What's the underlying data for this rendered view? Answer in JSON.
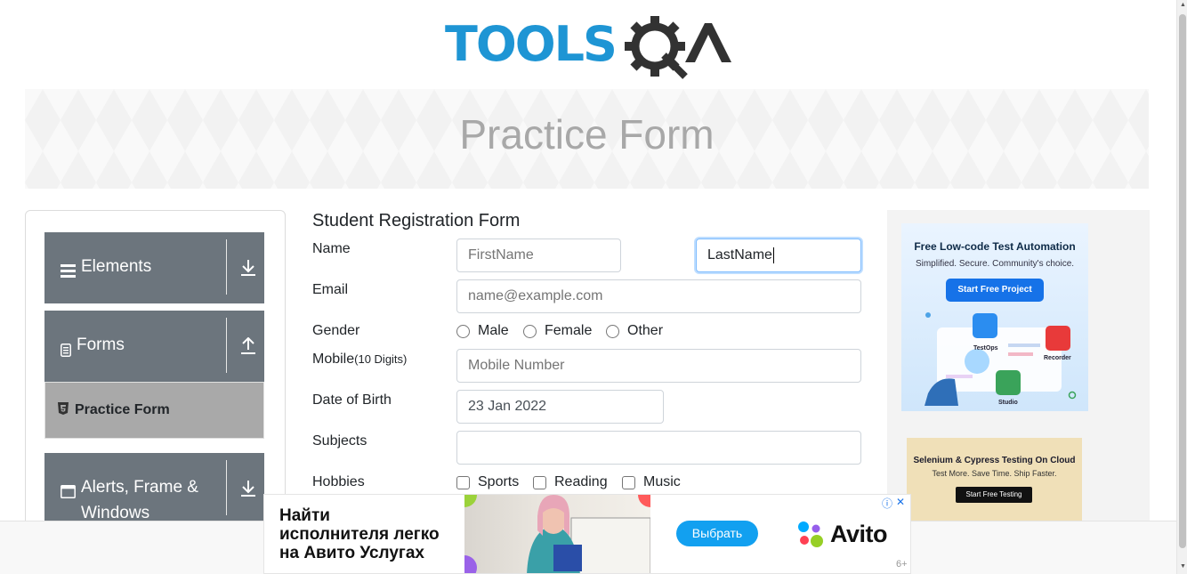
{
  "brand": {
    "logo_text": "TOOLSQA"
  },
  "banner": {
    "title": "Practice Form"
  },
  "sidebar": {
    "groups": [
      {
        "label": "Elements",
        "icon": "hamburger-icon",
        "arrow": "download-arrow-icon"
      },
      {
        "label": "Forms",
        "icon": "document-icon",
        "arrow": "upload-arrow-icon",
        "expanded": true,
        "items": [
          {
            "label": "Practice Form",
            "active": true
          }
        ]
      },
      {
        "label": "Alerts, Frame & Windows",
        "label_line1": "Alerts, Frame &",
        "label_line2": "Windows",
        "icon": "window-icon",
        "arrow": "download-arrow-icon"
      }
    ]
  },
  "form": {
    "title": "Student Registration Form",
    "name_label": "Name",
    "first_name_placeholder": "FirstName",
    "last_name_value": "LastName",
    "email_label": "Email",
    "email_placeholder": "name@example.com",
    "gender_label": "Gender",
    "gender_options": [
      "Male",
      "Female",
      "Other"
    ],
    "mobile_label": "Mobile",
    "mobile_hint": "(10 Digits)",
    "mobile_placeholder": "Mobile Number",
    "dob_label": "Date of Birth",
    "dob_value": "23 Jan 2022",
    "subjects_label": "Subjects",
    "subjects_value": "",
    "hobbies_label": "Hobbies",
    "hobbies_options": [
      "Sports",
      "Reading",
      "Music"
    ]
  },
  "ads": {
    "right_top": {
      "title": "Free Low-code Test Automation",
      "subtitle": "Simplified. Secure. Community's choice.",
      "button": "Start Free Project",
      "labels": [
        "TestOps",
        "Recorder",
        "Studio"
      ]
    },
    "right_bottom": {
      "title": "Selenium & Cypress Testing On Cloud",
      "subtitle": "Test More. Save Time. Ship Faster.",
      "button": "Start Free Testing"
    },
    "bottom": {
      "line1": "Найти",
      "line2": "исполнителя легко",
      "line3": "на Авито Услугах",
      "button": "Выбрать",
      "brand": "Avito",
      "age": "6+",
      "info_glyph": "ⓘ",
      "close_glyph": "✕"
    }
  },
  "colors": {
    "sidebar_group": "#6c757d",
    "sidebar_active": "#a9a9a9",
    "logo_blue": "#1e95d4",
    "logo_dark": "#323232",
    "focus_border": "#80bdff"
  }
}
